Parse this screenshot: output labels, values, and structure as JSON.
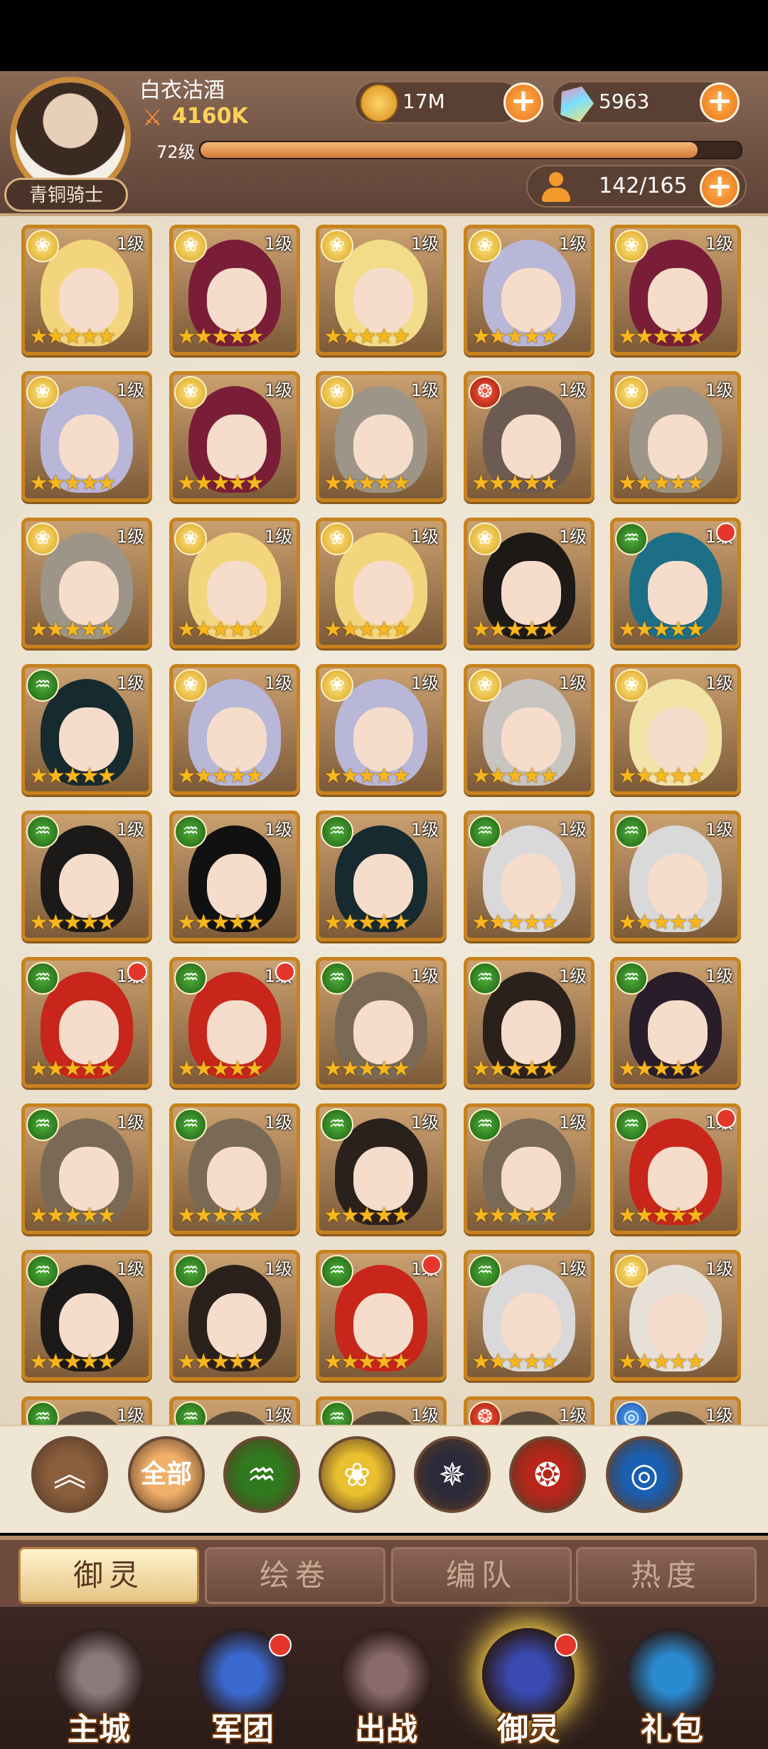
{
  "player": {
    "name": "白衣沽酒",
    "power": "4160K",
    "level": "72级",
    "level_progress": 0.92,
    "rank": "青铜骑士"
  },
  "resources": {
    "gold": "17M",
    "gems": "5963",
    "heroes": "142/165"
  },
  "hero_level_label": "1级",
  "stars": "★★★★★",
  "colors": {
    "frame": "#c7821e",
    "accent": "#f39a2c",
    "reddot": "#e5362b"
  },
  "heroes": [
    {
      "faction": "rose",
      "hair": "#f3d57e",
      "reddot": false
    },
    {
      "faction": "rose",
      "hair": "#7a1e38",
      "reddot": false
    },
    {
      "faction": "rose",
      "hair": "#f2dc8a",
      "reddot": false
    },
    {
      "faction": "rose",
      "hair": "#b9b7d8",
      "reddot": false
    },
    {
      "faction": "rose",
      "hair": "#7a1e38",
      "reddot": false
    },
    {
      "faction": "rose",
      "hair": "#b9b7d8",
      "reddot": false
    },
    {
      "faction": "rose",
      "hair": "#7a1e38",
      "reddot": false
    },
    {
      "faction": "rose",
      "hair": "#9d9587",
      "reddot": false
    },
    {
      "faction": "phoenix",
      "hair": "#6b5b52",
      "reddot": false
    },
    {
      "faction": "rose",
      "hair": "#9d9587",
      "reddot": false
    },
    {
      "faction": "rose",
      "hair": "#9d9587",
      "reddot": false
    },
    {
      "faction": "rose",
      "hair": "#f3d57e",
      "reddot": false
    },
    {
      "faction": "rose",
      "hair": "#f3d57e",
      "reddot": false
    },
    {
      "faction": "rose",
      "hair": "#1c1916",
      "reddot": false
    },
    {
      "faction": "nature",
      "hair": "#1c6f86",
      "reddot": true
    },
    {
      "faction": "nature",
      "hair": "#162a2f",
      "reddot": false
    },
    {
      "faction": "rose",
      "hair": "#b9b7d8",
      "reddot": false
    },
    {
      "faction": "rose",
      "hair": "#b9b7d8",
      "reddot": false
    },
    {
      "faction": "rose",
      "hair": "#c8c4c0",
      "reddot": false
    },
    {
      "faction": "rose",
      "hair": "#f2e3a6",
      "reddot": false
    },
    {
      "faction": "nature",
      "hair": "#1b1a18",
      "reddot": false
    },
    {
      "faction": "nature",
      "hair": "#111",
      "reddot": false
    },
    {
      "faction": "nature",
      "hair": "#162a2f",
      "reddot": false
    },
    {
      "faction": "nature",
      "hair": "#d9d9d9",
      "reddot": false
    },
    {
      "faction": "nature",
      "hair": "#d9d9d9",
      "reddot": false
    },
    {
      "faction": "nature",
      "hair": "#c8261b",
      "reddot": true
    },
    {
      "faction": "nature",
      "hair": "#c8261b",
      "reddot": true
    },
    {
      "faction": "nature",
      "hair": "#7a6a55",
      "reddot": false
    },
    {
      "faction": "nature",
      "hair": "#2b211c",
      "reddot": false
    },
    {
      "faction": "nature",
      "hair": "#2a1d2a",
      "reddot": false
    },
    {
      "faction": "nature",
      "hair": "#7a6a55",
      "reddot": false
    },
    {
      "faction": "nature",
      "hair": "#7a6a55",
      "reddot": false
    },
    {
      "faction": "nature",
      "hair": "#2b211c",
      "reddot": false
    },
    {
      "faction": "nature",
      "hair": "#7a6a55",
      "reddot": false
    },
    {
      "faction": "nature",
      "hair": "#c8261b",
      "reddot": true
    },
    {
      "faction": "nature",
      "hair": "#1b1a18",
      "reddot": false
    },
    {
      "faction": "nature",
      "hair": "#2b211c",
      "reddot": false
    },
    {
      "faction": "nature",
      "hair": "#c8261b",
      "reddot": true
    },
    {
      "faction": "nature",
      "hair": "#d9d9d9",
      "reddot": false
    },
    {
      "faction": "rose",
      "hair": "#e6e0d8",
      "reddot": false
    },
    {
      "faction": "nature",
      "hair": "#5a4a3a",
      "reddot": false
    },
    {
      "faction": "nature",
      "hair": "#5a4a3a",
      "reddot": false
    },
    {
      "faction": "nature",
      "hair": "#5a4a3a",
      "reddot": false
    },
    {
      "faction": "phoenix",
      "hair": "#5a4a3a",
      "reddot": false
    },
    {
      "faction": "water",
      "hair": "#5a4a3a",
      "reddot": false
    }
  ],
  "filters": [
    {
      "id": "collapse",
      "label": "",
      "icon": "double-chevron-up-icon",
      "bg": "#8a5f3e"
    },
    {
      "id": "all",
      "label": "全部",
      "icon": "all-filter-icon",
      "bg": "#f1b06a"
    },
    {
      "id": "nature",
      "label": "",
      "icon": "nature-faction-icon",
      "bg": "#2f7a1e"
    },
    {
      "id": "rose",
      "label": "",
      "icon": "rose-faction-icon",
      "bg": "#e9c02f"
    },
    {
      "id": "star",
      "label": "",
      "icon": "star-faction-icon",
      "bg": "#2a2a3a"
    },
    {
      "id": "phoenix",
      "label": "",
      "icon": "phoenix-faction-icon",
      "bg": "#b8251a"
    },
    {
      "id": "water",
      "label": "",
      "icon": "water-faction-icon",
      "bg": "#1a5fb0"
    }
  ],
  "tabs": [
    {
      "label": "御灵",
      "active": true
    },
    {
      "label": "绘卷",
      "active": false
    },
    {
      "label": "编队",
      "active": false
    },
    {
      "label": "热度",
      "active": false
    }
  ],
  "nav": [
    {
      "label": "主城",
      "icon": "castle-icon",
      "reddot": false,
      "active": false
    },
    {
      "label": "军团",
      "icon": "legion-shield-icon",
      "reddot": true,
      "active": false
    },
    {
      "label": "出战",
      "icon": "battle-gate-icon",
      "reddot": false,
      "active": false
    },
    {
      "label": "御灵",
      "icon": "spirit-crystal-icon",
      "reddot": true,
      "active": true
    },
    {
      "label": "礼包",
      "icon": "gift-shop-icon",
      "reddot": false,
      "active": false
    }
  ]
}
